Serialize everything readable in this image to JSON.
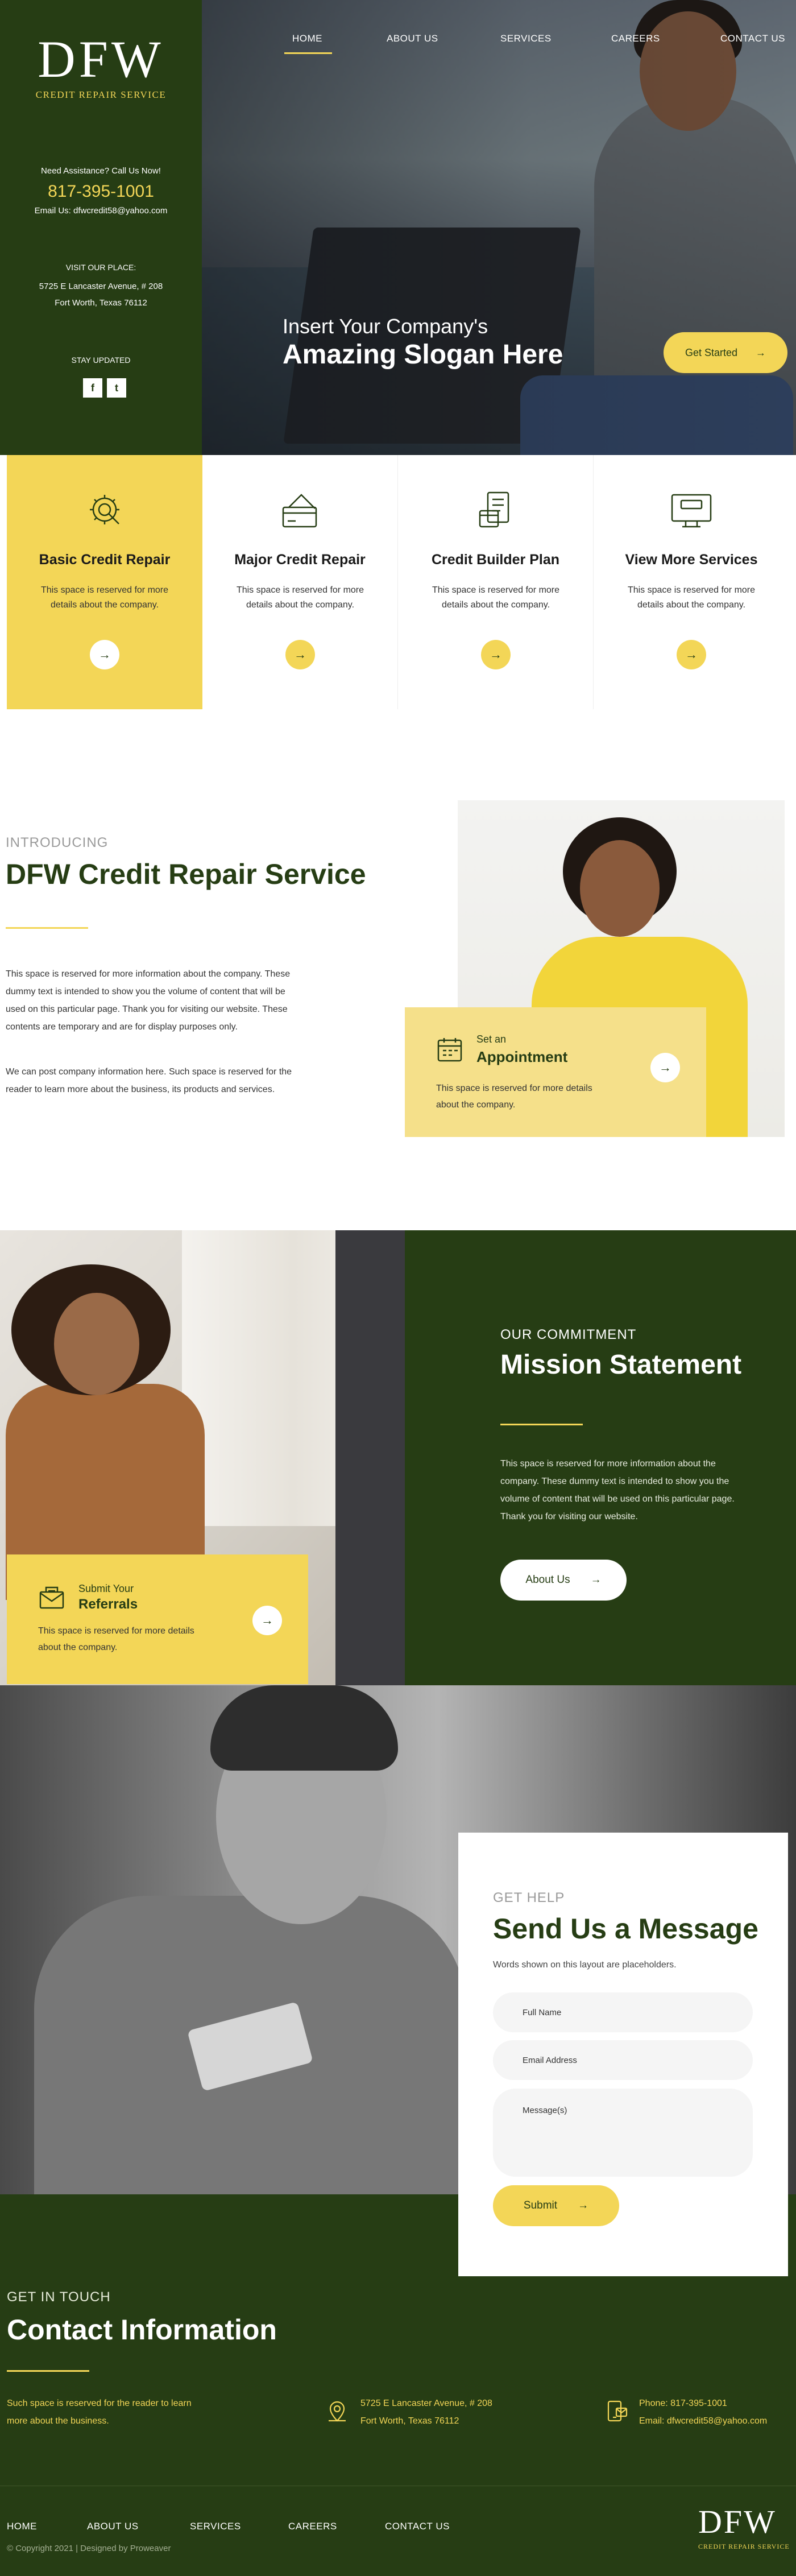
{
  "brand": {
    "logo": "DFW",
    "logo_sub": "CREDIT REPAIR SERVICE",
    "colors": {
      "green": "#263d14",
      "yellow": "#f3d657",
      "light_yellow": "#f5e08a"
    }
  },
  "sidebar": {
    "assistance": "Need Assistance? Call Us Now!",
    "phone": "817-395-1001",
    "email": "Email Us: dfwcredit58@yahoo.com",
    "visit_label": "VISIT OUR PLACE:",
    "address_line1": "5725 E Lancaster Avenue, # 208",
    "address_line2": "Fort Worth, Texas 76112",
    "stay_updated": "STAY UPDATED",
    "social": [
      {
        "icon": "facebook-icon",
        "glyph": "f"
      },
      {
        "icon": "twitter-icon",
        "glyph": "t"
      }
    ]
  },
  "nav": {
    "items": [
      "HOME",
      "ABOUT US",
      "SERVICES",
      "CAREERS",
      "CONTACT US"
    ],
    "active": "HOME"
  },
  "hero": {
    "slogan_small": "Insert Your Company's",
    "slogan_big": "Amazing Slogan Here",
    "cta": "Get Started",
    "cta_icon": "arrow-right-icon"
  },
  "services": [
    {
      "icon": "gear-search-icon",
      "title": "Basic Credit Repair",
      "desc": "This space is reserved for more details about the company.",
      "active": true
    },
    {
      "icon": "credit-card-icon",
      "title": "Major Credit Repair",
      "desc": "This space is reserved for more details about the company.",
      "active": false
    },
    {
      "icon": "document-card-icon",
      "title": "Credit Builder Plan",
      "desc": "This space is reserved for more details about the company.",
      "active": false
    },
    {
      "icon": "credit-monitor-icon",
      "title": "View More Services",
      "desc": "This space is reserved for more details about the company.",
      "active": false
    }
  ],
  "intro": {
    "label": "INTRODUCING",
    "title": "DFW Credit Repair Service",
    "p1_l1": "This space is reserved for more information about the company. These",
    "p1_l2": "dummy text is intended to show you the volume of content that will be",
    "p1_l3": "used on this particular page.  Thank you for visiting our website. These",
    "p1_l4": "contents are temporary and are for display purposes only.",
    "p2_l1": "We can post company information here. Such space is reserved for the",
    "p2_l2": "reader to learn more about the business, its products and services."
  },
  "appointment": {
    "small": "Set an",
    "big": "Appointment",
    "desc_l1": "This space is reserved for more details",
    "desc_l2": "about the company."
  },
  "mission": {
    "label": "OUR COMMITMENT",
    "title": "Mission Statement",
    "p_l1": "This space is reserved for more information about the",
    "p_l2": "company. These dummy text is intended to show you the",
    "p_l3": "volume of content that will be used on this particular page.",
    "p_l4": "Thank you for visiting our website.",
    "button": "About Us"
  },
  "referrals": {
    "small": "Submit Your",
    "big": "Referrals",
    "desc_l1": "This space is reserved for more details",
    "desc_l2": "about the company."
  },
  "form": {
    "label": "GET HELP",
    "title": "Send Us a Message",
    "subtitle": "Words shown on this layout are placeholders.",
    "name_placeholder": "Full Name",
    "email_placeholder": "Email Address",
    "message_placeholder": "Message(s)",
    "submit": "Submit"
  },
  "contact": {
    "label": "GET IN TOUCH",
    "title": "Contact Information",
    "desc_l1": "Such space is reserved for the reader to learn",
    "desc_l2": "more about the business.",
    "address_l1": "5725 E Lancaster Avenue, # 208",
    "address_l2": "Fort Worth, Texas 76112",
    "phone": "Phone: 817-395-1001",
    "email": "Email: dfwcredit58@yahoo.com"
  },
  "footer": {
    "nav": [
      "HOME",
      "ABOUT US",
      "SERVICES",
      "CAREERS",
      "CONTACT US"
    ],
    "copyright": "© Copyright 2021 | Designed by Proweaver"
  }
}
